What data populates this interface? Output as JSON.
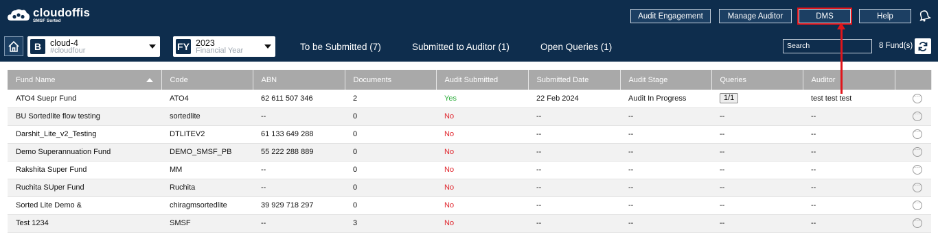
{
  "logo": {
    "name": "cloudoffis",
    "tagline": "SMSF Sorted"
  },
  "top_buttons": [
    {
      "label": "Audit Engagement"
    },
    {
      "label": "Manage Auditor"
    },
    {
      "label": "DMS"
    },
    {
      "label": "Help"
    }
  ],
  "fund_select": {
    "badge": "B",
    "name": "cloud-4",
    "code": "#cloudfour"
  },
  "year_select": {
    "badge": "FY",
    "year": "2023",
    "label": "Financial Year"
  },
  "tabs": [
    {
      "label": "To be Submitted (7)"
    },
    {
      "label": "Submitted to Auditor (1)"
    },
    {
      "label": "Open Queries (1)"
    }
  ],
  "search": {
    "placeholder": "Search"
  },
  "fund_count": "8 Fund(s)",
  "table": {
    "headers": [
      "Fund Name",
      "Code",
      "ABN",
      "Documents",
      "Audit Submitted",
      "Submitted Date",
      "Audit Stage",
      "Queries",
      "Auditor",
      ""
    ],
    "rows": [
      {
        "fund": "ATO4 Suepr Fund",
        "code": "ATO4",
        "abn": "62 611 507 346",
        "docs": "2",
        "submitted": "Yes",
        "date": "22 Feb 2024",
        "stage": "Audit In Progress",
        "queries": "1/1",
        "auditor": "test test test"
      },
      {
        "fund": "BU Sortedlite flow testing",
        "code": "sortedlite",
        "abn": "--",
        "docs": "0",
        "submitted": "No",
        "date": "--",
        "stage": "--",
        "queries": "--",
        "auditor": "--"
      },
      {
        "fund": "Darshit_Lite_v2_Testing",
        "code": "DTLITEV2",
        "abn": "61 133 649 288",
        "docs": "0",
        "submitted": "No",
        "date": "--",
        "stage": "--",
        "queries": "--",
        "auditor": "--"
      },
      {
        "fund": "Demo Superannuation Fund",
        "code": "DEMO_SMSF_PB",
        "abn": "55 222 288 889",
        "docs": "0",
        "submitted": "No",
        "date": "--",
        "stage": "--",
        "queries": "--",
        "auditor": "--"
      },
      {
        "fund": "Rakshita Super Fund",
        "code": "MM",
        "abn": "--",
        "docs": "0",
        "submitted": "No",
        "date": "--",
        "stage": "--",
        "queries": "--",
        "auditor": "--"
      },
      {
        "fund": "Ruchita SUper Fund",
        "code": "Ruchita",
        "abn": "--",
        "docs": "0",
        "submitted": "No",
        "date": "--",
        "stage": "--",
        "queries": "--",
        "auditor": "--"
      },
      {
        "fund": "Sorted Lite Demo &",
        "code": "chiragmsortedlite",
        "abn": "39 929 718 297",
        "docs": "0",
        "submitted": "No",
        "date": "--",
        "stage": "--",
        "queries": "--",
        "auditor": "--"
      },
      {
        "fund": "Test 1234",
        "code": "SMSF",
        "abn": "--",
        "docs": "3",
        "submitted": "No",
        "date": "--",
        "stage": "--",
        "queries": "--",
        "auditor": "--"
      }
    ]
  },
  "colors": {
    "navy": "#0e2d4d",
    "highlight": "#e0151b",
    "yes": "#2fae3d",
    "no": "#e0252d",
    "header_gray": "#a9a9a9"
  }
}
